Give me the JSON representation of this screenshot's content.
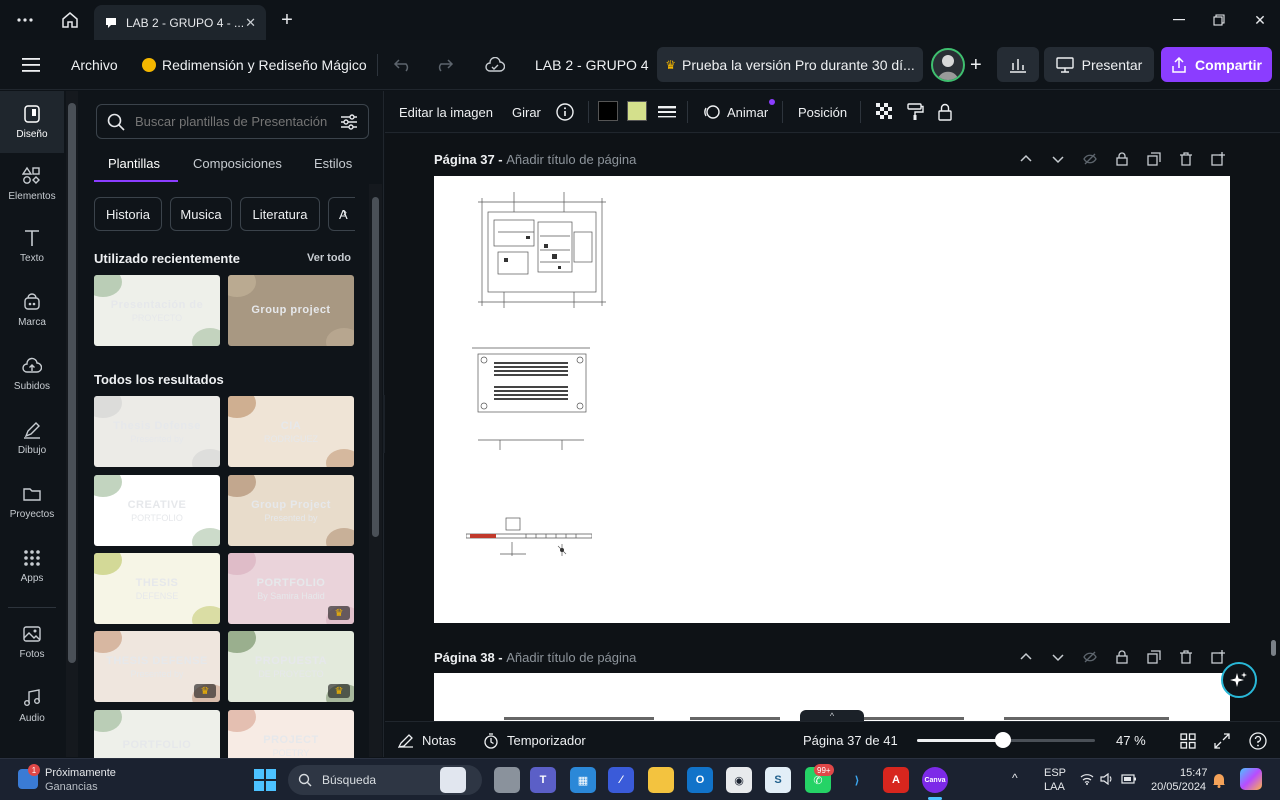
{
  "browser": {
    "tab_title": "LAB 2 - GRUPO 4 - ...",
    "window_controls": [
      "minimize-icon",
      "restore-icon",
      "close-icon"
    ]
  },
  "topbar": {
    "archivo": "Archivo",
    "magic_resize": "Redimensión y Rediseño Mágico",
    "doc_title": "LAB 2 - GRUPO 4",
    "pro_trial": "Prueba la versión Pro durante 30 dí...",
    "present": "Presentar",
    "share": "Compartir",
    "colors": {
      "accent": "#8b3dff",
      "pro_crown": "#f5b700"
    }
  },
  "rail": [
    {
      "label": "Diseño",
      "icon": "design-icon",
      "active": true
    },
    {
      "label": "Elementos",
      "icon": "elements-icon"
    },
    {
      "label": "Texto",
      "icon": "text-icon"
    },
    {
      "label": "Marca",
      "icon": "brand-icon"
    },
    {
      "label": "Subidos",
      "icon": "upload-icon"
    },
    {
      "label": "Dibujo",
      "icon": "draw-icon"
    },
    {
      "label": "Proyectos",
      "icon": "folder-icon"
    },
    {
      "label": "Apps",
      "icon": "apps-icon"
    },
    {
      "label": "Fotos",
      "icon": "photos-icon"
    },
    {
      "label": "Audio",
      "icon": "audio-icon"
    }
  ],
  "panel": {
    "search_placeholder": "Buscar plantillas de Presentación",
    "tabs": [
      "Plantillas",
      "Composiciones",
      "Estilos"
    ],
    "chips": [
      "Historia",
      "Musica",
      "Literatura",
      "A"
    ],
    "recent_title": "Utilizado recientemente",
    "see_all": "Ver todo",
    "recent": [
      {
        "line1": "Presentación de",
        "line2": "PROYECTO"
      },
      {
        "line1": "Group project",
        "line2": ""
      }
    ],
    "all_title": "Todos los resultados",
    "results": [
      {
        "line1": "Thesis Defense",
        "line2": "Presented by"
      },
      {
        "line1": "CIA",
        "line2": "RODRIGUEZ"
      },
      {
        "line1": "CREATIVE",
        "line2": "PORTFOLIO"
      },
      {
        "line1": "Group Project",
        "line2": "Presented by"
      },
      {
        "line1": "THESIS",
        "line2": "DEFENSE"
      },
      {
        "line1": "PORTFOLIO",
        "line2": "By Samira Hadid"
      },
      {
        "line1": "THESIS DEFENSE",
        "line2": "Presented by"
      },
      {
        "line1": "PROPUESTA",
        "line2": "DE PROYECTO"
      },
      {
        "line1": "PORTFOLIO",
        "line2": ""
      },
      {
        "line1": "PROJECT",
        "line2": "POETRY"
      }
    ]
  },
  "editor_toolbar": {
    "edit_image": "Editar la imagen",
    "rotate": "Girar",
    "animate": "Animar",
    "position": "Posición",
    "swatches": [
      "#000000",
      "#d4e08c"
    ]
  },
  "pages": [
    {
      "label": "Página 37 -",
      "title_placeholder": "Añadir título de página"
    },
    {
      "label": "Página 38 -",
      "title_placeholder": "Añadir título de página"
    }
  ],
  "status": {
    "notes": "Notas",
    "timer": "Temporizador",
    "page_indicator": "Página 37 de 41",
    "zoom_label": "47 %",
    "zoom_value": 47
  },
  "taskbar": {
    "news_title": "Próximamente",
    "news_sub": "Ganancias",
    "news_badge": "1",
    "search": "Búsqueda",
    "whatsapp_badge": "99+",
    "lang_top": "ESP",
    "lang_bottom": "LAA",
    "time": "15:47",
    "date": "20/05/2024",
    "canva_label": "Canva"
  }
}
